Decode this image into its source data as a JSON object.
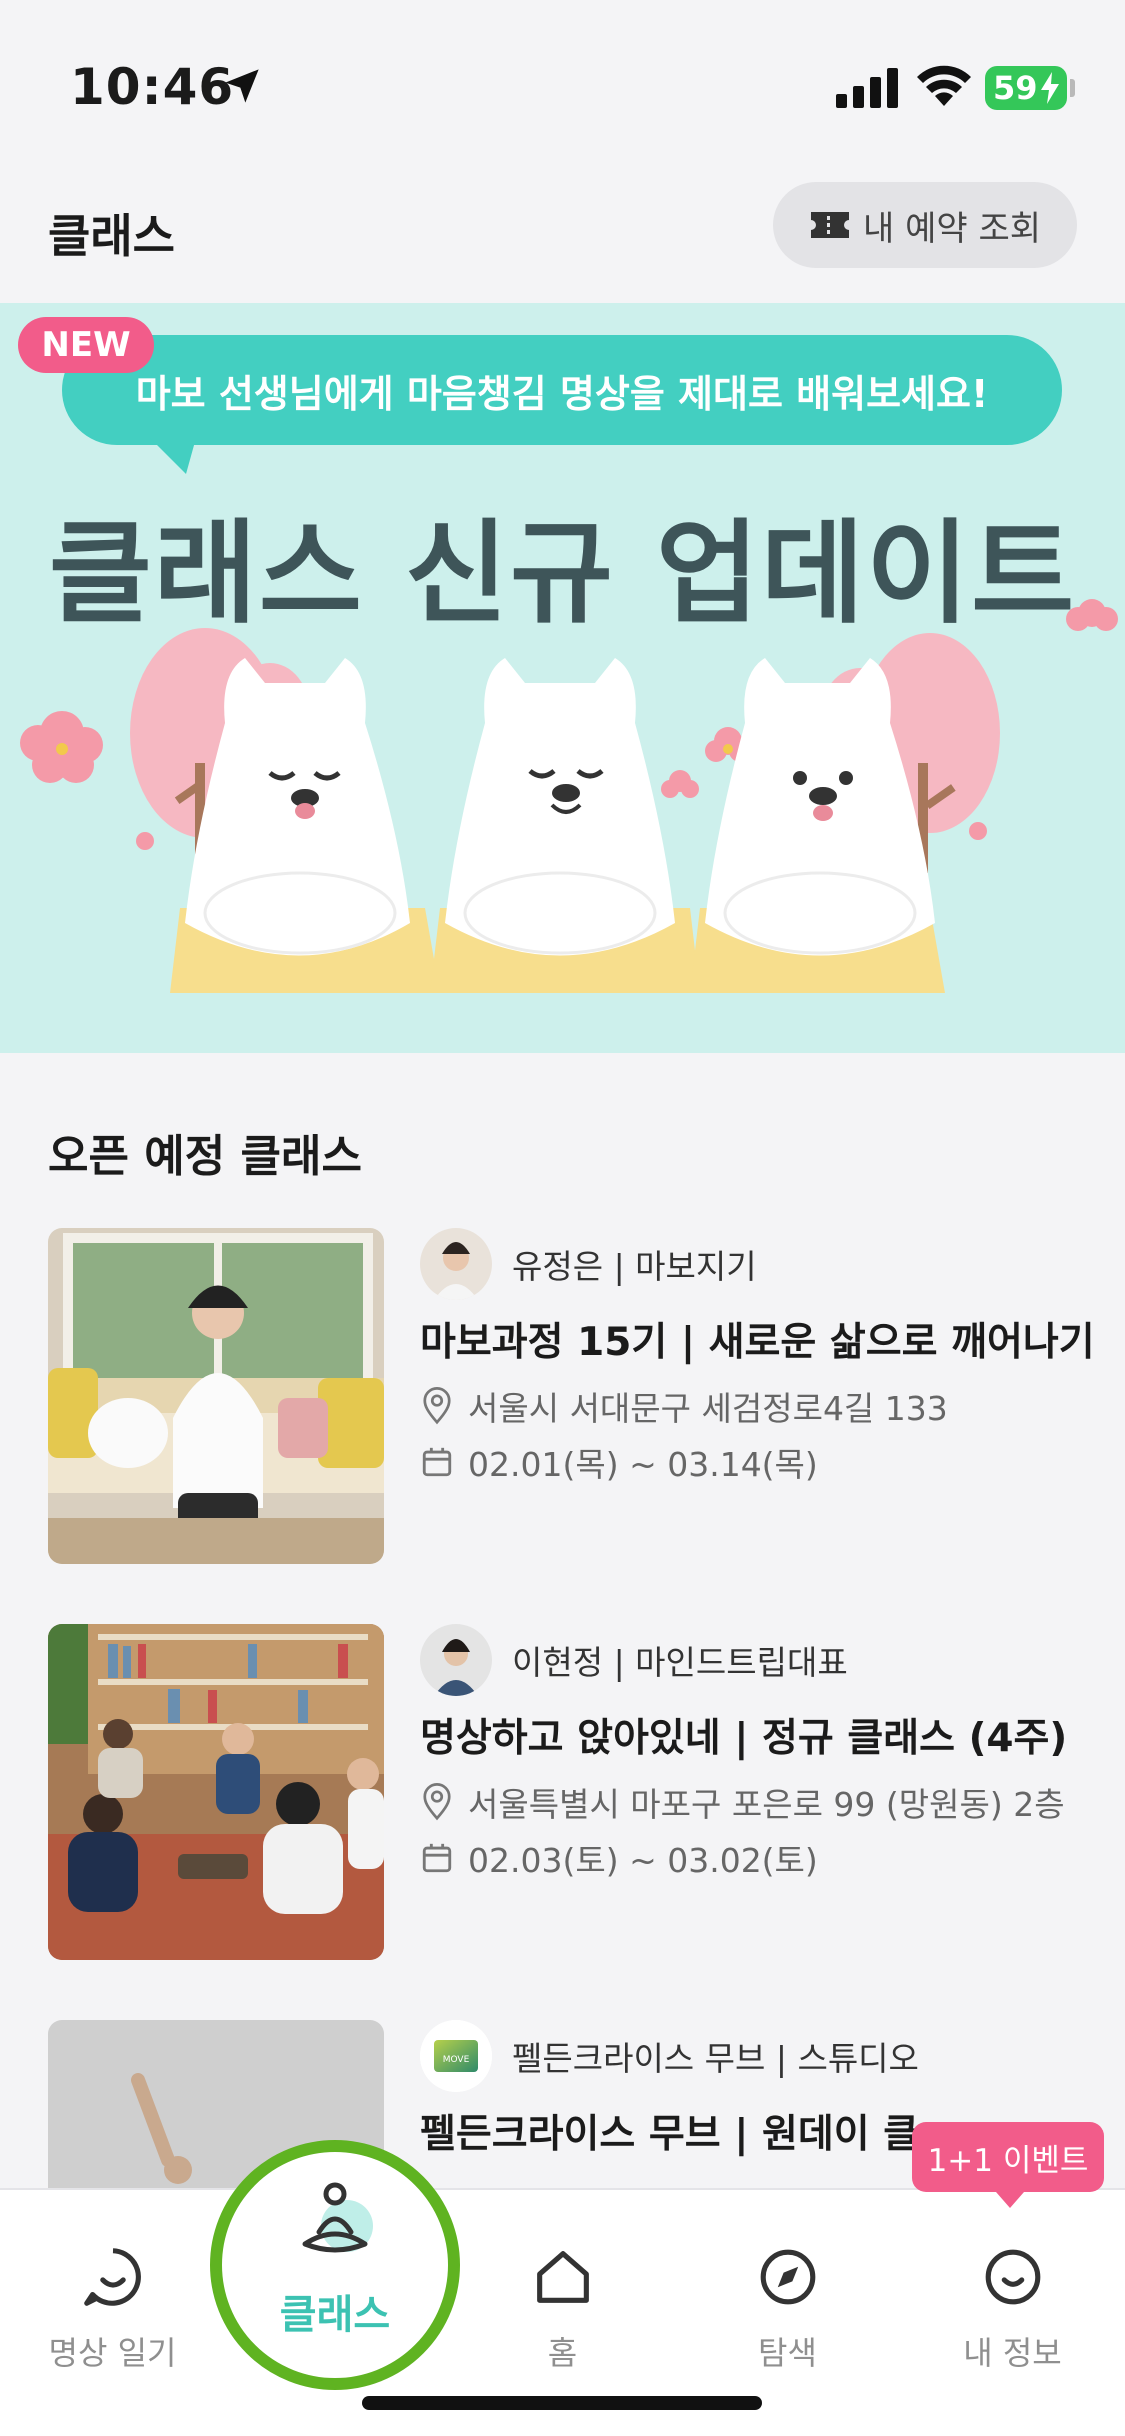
{
  "status_bar": {
    "time": "10:46",
    "battery": "59"
  },
  "header": {
    "title": "클래스",
    "reserve_button": "내 예약 조회"
  },
  "banner": {
    "badge": "NEW",
    "bubble_text": "마보 선생님에게 마음챙김 명상을 제대로 배워보세요!",
    "title": "클래스 신규 업데이트"
  },
  "section": {
    "title": "오픈 예정 클래스"
  },
  "classes": [
    {
      "instructor": "유정은 | 마보지기",
      "title": "마보과정 15기  | 새로운 삶으로 깨어나기",
      "location": "서울시 서대문구 세검정로4길 133",
      "date": "02.01(목) ~ 03.14(목)"
    },
    {
      "instructor": "이현정 | 마인드트립대표",
      "title": "명상하고 앉아있네  |  정규 클래스 (4주)",
      "location": "서울특별시 마포구 포은로 99 (망원동) 2층",
      "date": "02.03(토) ~ 03.02(토)"
    },
    {
      "instructor": "펠든크라이스 무브 | 스튜디오",
      "title": "펠든크라이스 무브  | 원데이 클",
      "logo_text": "MOVE"
    }
  ],
  "event_badge": "1+1 이벤트",
  "nav": {
    "diary": "명상 일기",
    "class": "클래스",
    "home": "홈",
    "explore": "탐색",
    "profile": "내 정보"
  },
  "colors": {
    "accent": "#43cfc1",
    "badge": "#f25c8a",
    "active_ring": "#5fb321",
    "banner_bg": "#cdf0ec"
  }
}
